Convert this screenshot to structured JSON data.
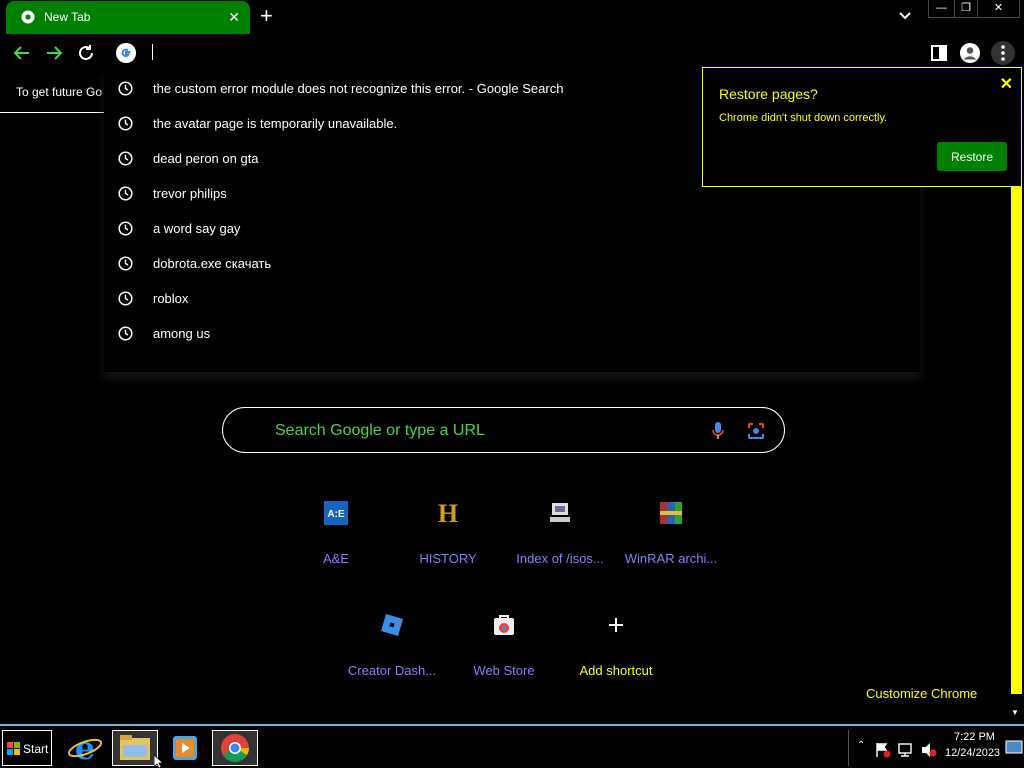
{
  "browser": {
    "tab": {
      "title": "New Tab",
      "close": "✕"
    },
    "new_tab": "+",
    "window_controls": {
      "minimize": "—",
      "restore": "❐",
      "close": "✕"
    },
    "omnibox_value": ""
  },
  "left_page": {
    "infobar_text": "To get future Go"
  },
  "suggestions": [
    "the custom error module does not recognize this error. - Google Search",
    "the avatar page is temporarily unavailable.",
    "dead peron on gta",
    "trevor philips",
    "a word say gay",
    "dobrota.exe скачать",
    "roblox",
    "among us"
  ],
  "restore_bubble": {
    "title": "Restore pages?",
    "message": "Chrome didn't shut down correctly.",
    "button": "Restore",
    "close": "✕"
  },
  "ntp": {
    "search_placeholder": "Search Google or type a URL",
    "shortcuts": [
      {
        "label": "A&E",
        "icon": "ae-icon"
      },
      {
        "label": "HISTORY",
        "icon": "history-icon"
      },
      {
        "label": "Index of /isos...",
        "icon": "index-icon"
      },
      {
        "label": "WinRAR archi...",
        "icon": "winrar-icon"
      },
      {
        "label": "Creator Dash...",
        "icon": "roblox-icon"
      },
      {
        "label": "Web Store",
        "icon": "webstore-icon"
      },
      {
        "label": "Add shortcut",
        "icon": "plus-icon"
      }
    ],
    "customize": "Customize Chrome"
  },
  "taskbar": {
    "start_label": "Start",
    "time": "7:22 PM",
    "date": "12/24/2023"
  },
  "colors": {
    "tab_green": "#008000",
    "accent_yellow": "#ffff00",
    "link_blue": "#8080ff",
    "placeholder_green": "#4cd34c"
  }
}
